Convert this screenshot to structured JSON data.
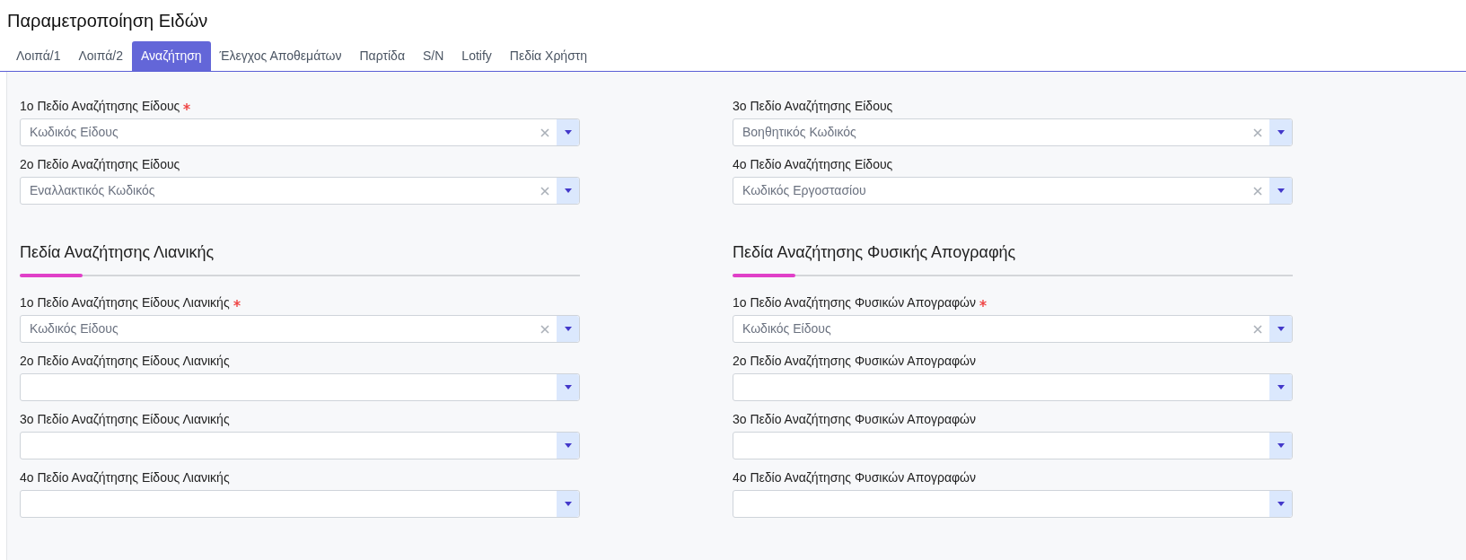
{
  "title": "Παραμετροποίηση Ειδών",
  "tabs": [
    {
      "label": "Λοιπά/1",
      "selected": false
    },
    {
      "label": "Λοιπά/2",
      "selected": false
    },
    {
      "label": "Αναζήτηση",
      "selected": true
    },
    {
      "label": "Έλεγχος Αποθεμάτων",
      "selected": false
    },
    {
      "label": "Παρτίδα",
      "selected": false
    },
    {
      "label": "S/N",
      "selected": false
    },
    {
      "label": "Lotify",
      "selected": false
    },
    {
      "label": "Πεδία Χρήστη",
      "selected": false
    }
  ],
  "columns": [
    {
      "fields": [
        {
          "label": "1ο Πεδίο Αναζήτησης Είδους",
          "required": true,
          "value": "Κωδικός Είδους"
        },
        {
          "label": "2ο Πεδίο Αναζήτησης Είδους",
          "required": false,
          "value": "Εναλλακτικός Κωδικός"
        }
      ],
      "section": {
        "title": "Πεδία Αναζήτησης Λιανικής",
        "fields": [
          {
            "label": "1ο Πεδίο Αναζήτησης Είδους Λιανικής",
            "required": true,
            "value": "Κωδικός Είδους"
          },
          {
            "label": "2ο Πεδίο Αναζήτησης Είδους Λιανικής",
            "required": false
          },
          {
            "label": "3ο Πεδίο Αναζήτησης Είδους Λιανικής",
            "required": false
          },
          {
            "label": "4ο Πεδίο Αναζήτησης Είδους Λιανικής",
            "required": false
          }
        ]
      }
    },
    {
      "fields": [
        {
          "label": "3ο Πεδίο Αναζήτησης Είδους",
          "required": false,
          "value": "Βοηθητικός Κωδικός"
        },
        {
          "label": "4ο Πεδίο Αναζήτησης Είδους",
          "required": false,
          "value": "Κωδικός Εργοστασίου"
        }
      ],
      "section": {
        "title": "Πεδία Αναζήτησης Φυσικής Απογραφής",
        "fields": [
          {
            "label": "1ο Πεδίο Αναζήτησης Φυσικών Απογραφών",
            "required": true,
            "value": "Κωδικός Είδους"
          },
          {
            "label": "2ο Πεδίο Αναζήτησης Φυσικών Απογραφών",
            "required": false
          },
          {
            "label": "3ο Πεδίο Αναζήτησης Φυσικών Απογραφών",
            "required": false
          },
          {
            "label": "4ο Πεδίο Αναζήτησης Φυσικών Απογραφών",
            "required": false
          }
        ]
      }
    }
  ]
}
